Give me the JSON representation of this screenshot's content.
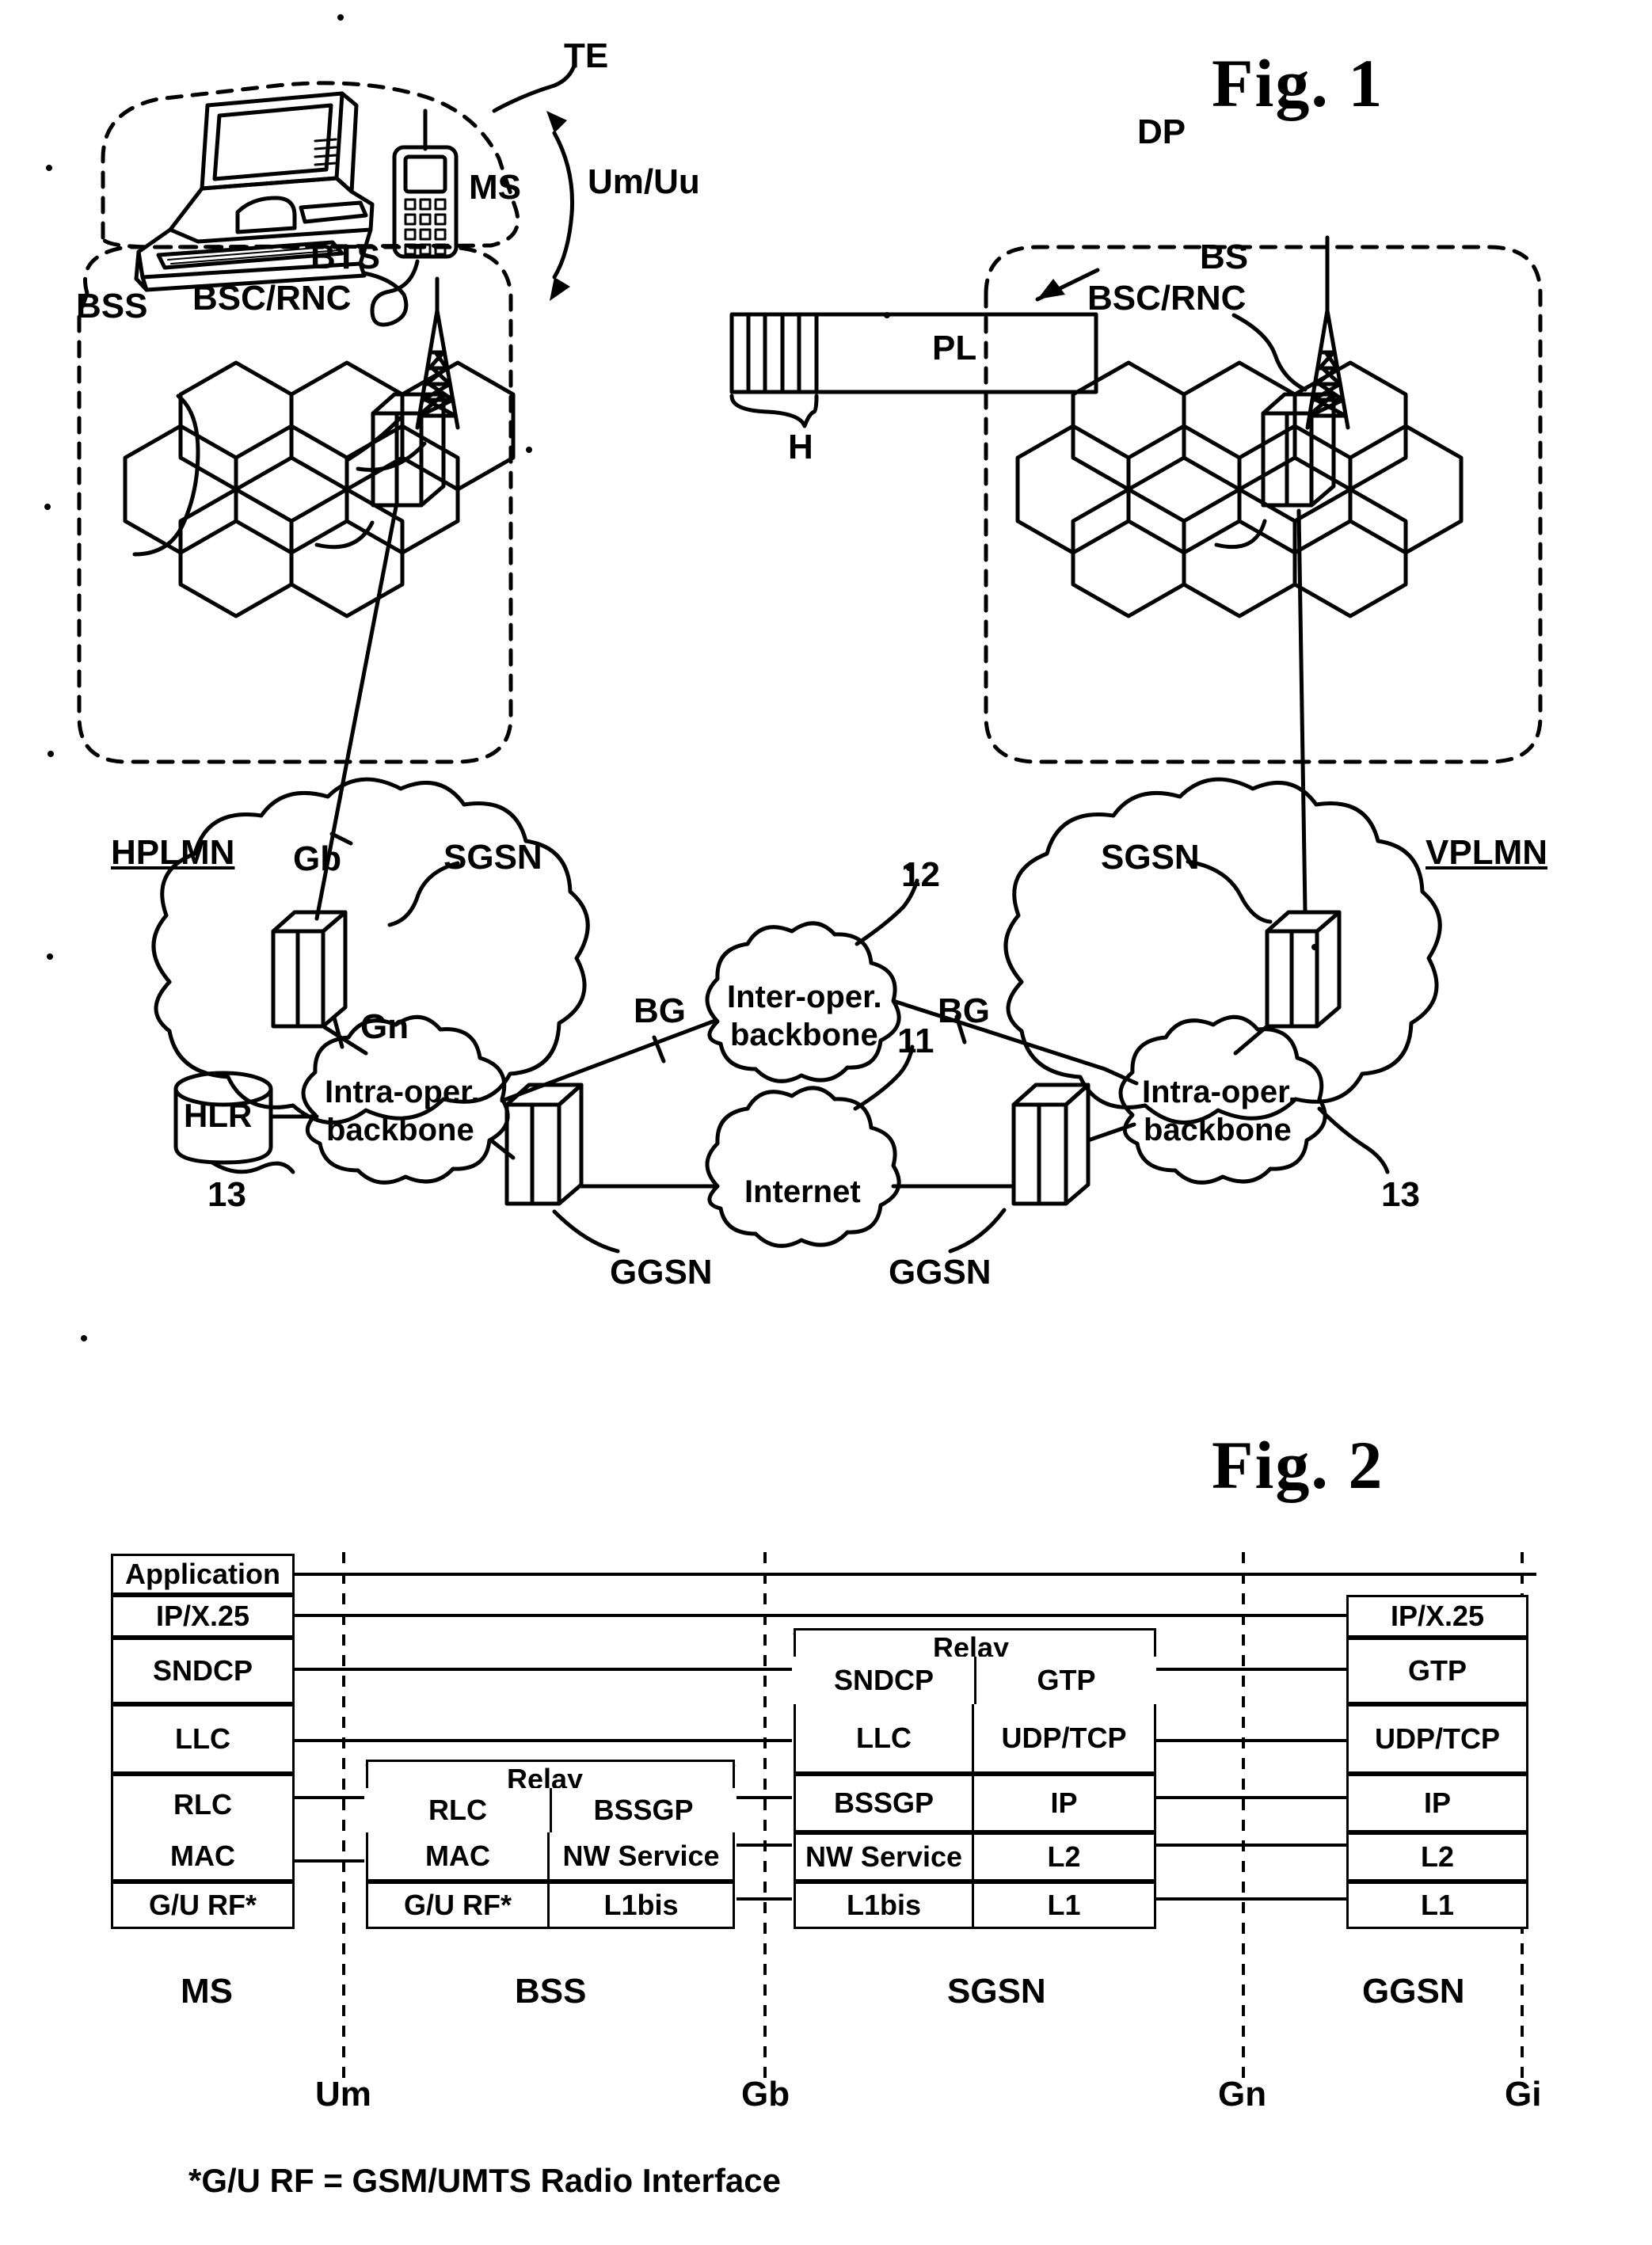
{
  "figures": {
    "fig1": {
      "title": "Fig. 1",
      "labels": {
        "te": "TE",
        "ms": "MS",
        "dp": "DP",
        "pl": "PL",
        "h": "H",
        "um_uu": "Um/Uu",
        "bts": "BTS",
        "bs": "BS",
        "bsc_rnc_left": "BSC/RNC",
        "bsc_rnc_right": "BSC/RNC",
        "bss": "BSS",
        "hplmn": "HPLMN",
        "vplmn": "VPLMN",
        "gb": "Gb",
        "gn": "Gn",
        "sgsn_left": "SGSN",
        "sgsn_right": "SGSN",
        "ggsn_left": "GGSN",
        "ggsn_right": "GGSN",
        "hlr": "HLR",
        "bg_left": "BG",
        "bg_right": "BG",
        "intra_left": "Intra-oper.\nbackbone",
        "intra_right": "Intra-oper.\nbackbone",
        "inter": "Inter-oper.\nbackbone",
        "internet": "Internet",
        "ref_11": "11",
        "ref_12": "12",
        "ref_13_left": "13",
        "ref_13_right": "13"
      },
      "cloud_text": {
        "intra_line1": "Intra-oper.",
        "intra_line2": "backbone",
        "inter_line1": "Inter-oper.",
        "inter_line2": "backbone",
        "internet": "Internet"
      }
    },
    "fig2": {
      "title": "Fig. 2",
      "footnote": "*G/U RF = GSM/UMTS  Radio Interface",
      "relay_label": "Relay",
      "columns": [
        {
          "name": "MS",
          "bottom_label": "MS",
          "layers": [
            {
              "label": "Application"
            },
            {
              "label": "IP/X.25"
            },
            {
              "label": "SNDCP"
            },
            {
              "label": "LLC"
            },
            {
              "label": "RLC"
            },
            {
              "label": "MAC"
            },
            {
              "label": "G/U RF*"
            }
          ]
        },
        {
          "name": "BSS",
          "bottom_label": "BSS",
          "has_relay": true,
          "layers_left": [
            {
              "label": "RLC"
            },
            {
              "label": "MAC"
            },
            {
              "label": "G/U RF*"
            }
          ],
          "layers_right": [
            {
              "label": "BSSGP"
            },
            {
              "label": "NW Service"
            },
            {
              "label": "L1bis"
            }
          ]
        },
        {
          "name": "SGSN",
          "bottom_label": "SGSN",
          "has_relay": true,
          "layers_left": [
            {
              "label": "SNDCP"
            },
            {
              "label": "LLC"
            },
            {
              "label": "BSSGP"
            },
            {
              "label": "NW Service"
            },
            {
              "label": "L1bis"
            }
          ],
          "layers_right": [
            {
              "label": "GTP"
            },
            {
              "label": "UDP/TCP"
            },
            {
              "label": "IP"
            },
            {
              "label": "L2"
            },
            {
              "label": "L1"
            }
          ]
        },
        {
          "name": "GGSN",
          "bottom_label": "GGSN",
          "layers": [
            {
              "label": "IP/X.25"
            },
            {
              "label": "GTP"
            },
            {
              "label": "UDP/TCP"
            },
            {
              "label": "IP"
            },
            {
              "label": "L2"
            },
            {
              "label": "L1"
            }
          ]
        }
      ],
      "interfaces": [
        {
          "label": "Um"
        },
        {
          "label": "Gb"
        },
        {
          "label": "Gn"
        },
        {
          "label": "Gi"
        }
      ]
    }
  },
  "colors": {
    "ink": "#000000",
    "paper": "#ffffff"
  }
}
